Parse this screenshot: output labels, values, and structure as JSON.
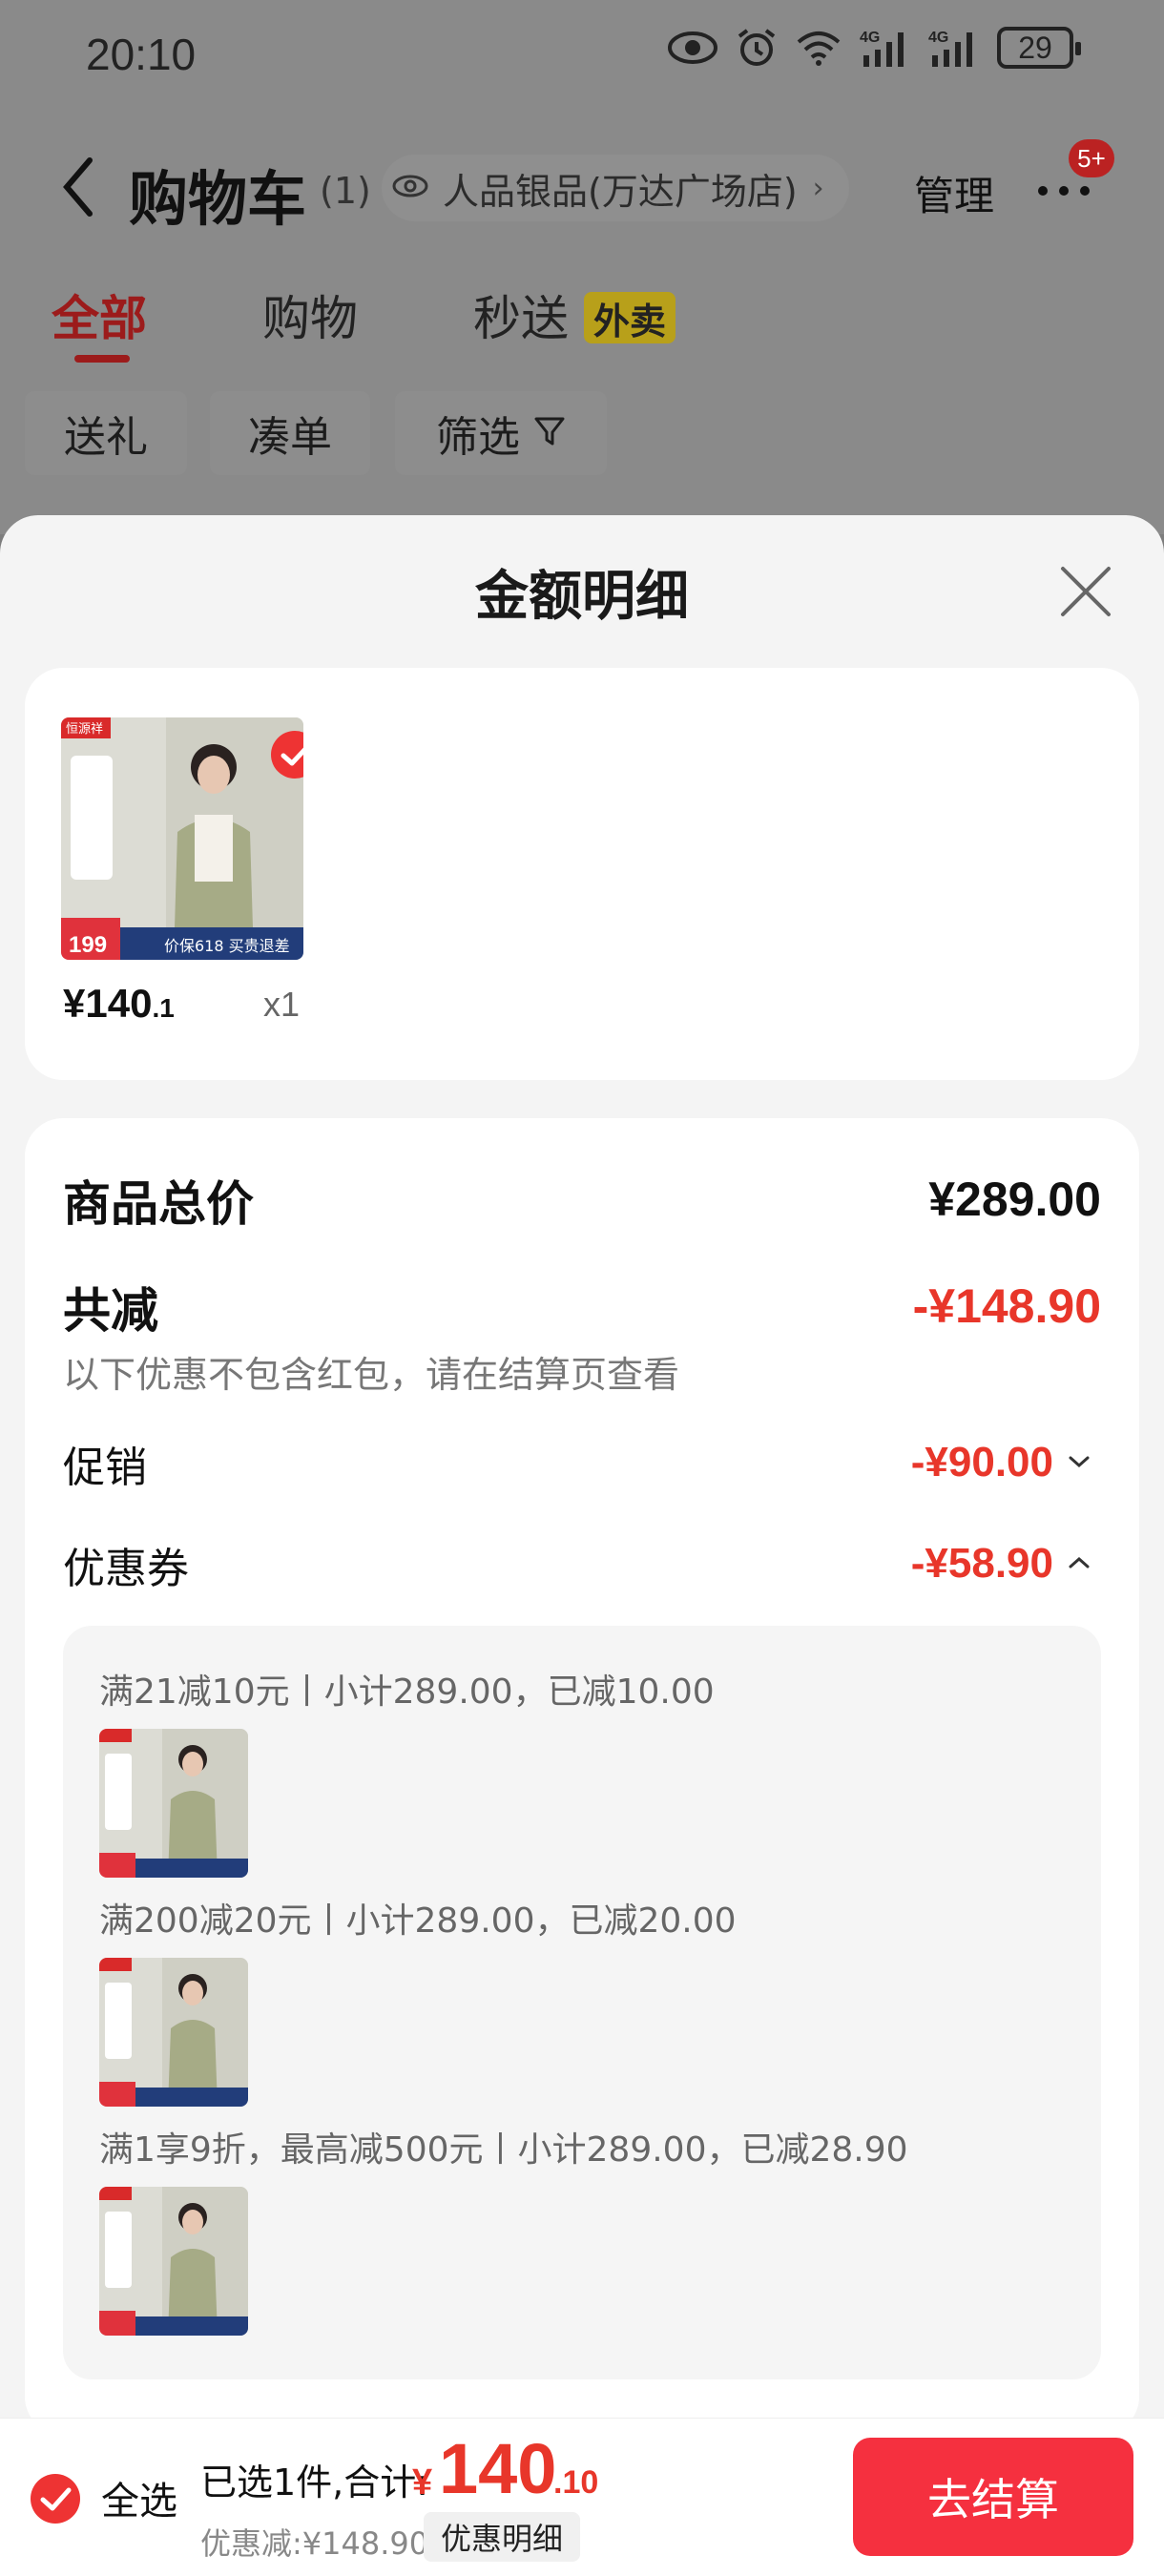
{
  "status_bar": {
    "time": "20:10",
    "signal_labels": [
      "4G",
      "4G"
    ],
    "battery": "29",
    "icons": [
      "eye-icon",
      "alarm-icon",
      "wifi-icon",
      "signal-icon",
      "signal-icon",
      "battery-icon"
    ]
  },
  "header": {
    "title": "购物车",
    "count": "(1)",
    "store_name": "人品银品(万达广场店)",
    "manage_label": "管理",
    "more_badge": "5+"
  },
  "tabs": [
    {
      "label": "全部",
      "active": true
    },
    {
      "label": "购物",
      "active": false
    },
    {
      "label": "秒送",
      "active": false,
      "tag": "外卖"
    }
  ],
  "chips": [
    {
      "label": "送礼"
    },
    {
      "label": "凑单"
    },
    {
      "label": "筛选"
    }
  ],
  "sheet": {
    "title": "金额明细",
    "product": {
      "price_int": "¥140",
      "price_dec": ".1",
      "qty": "x1",
      "thumb_brand": "恒源祥",
      "thumb_price": "199",
      "thumb_banner": "价保618 买贵退差"
    },
    "total_label": "商品总价",
    "total_value": "¥289.00",
    "reduce_label": "共减",
    "reduce_value": "-¥148.90",
    "reduce_note": "以下优惠不包含红包，请在结算页查看",
    "promo_label": "促销",
    "promo_value": "-¥90.00",
    "coupon_label": "优惠券",
    "coupon_value": "-¥58.90",
    "coupons": [
      {
        "text": "满21减10元丨小计289.00，已减10.00"
      },
      {
        "text": "满200减20元丨小计289.00，已减20.00"
      },
      {
        "text": "满1享9折，最高减500元丨小计289.00，已减28.90"
      }
    ]
  },
  "bottom_bar": {
    "select_all": "全选",
    "summary": "已选1件,合计:",
    "total_symbol": "¥",
    "total_int": "140",
    "total_dec": ".10",
    "discount": "优惠减:¥148.90",
    "detail_button": "优惠明细",
    "checkout_button": "去结算"
  },
  "colors": {
    "accent_red": "#e8362a",
    "checkout_red": "#f5303f",
    "dim_overlay": "#7d7d7d"
  }
}
